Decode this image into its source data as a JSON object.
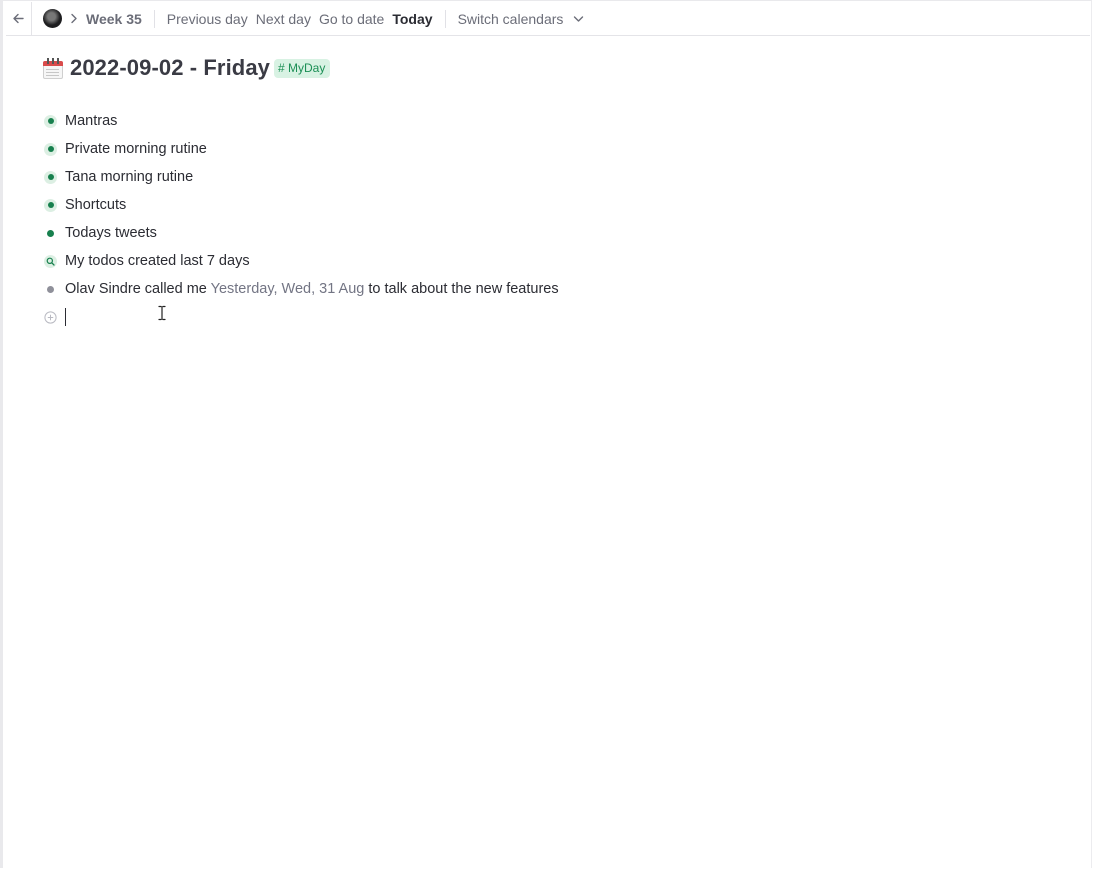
{
  "topbar": {
    "back_icon": "arrow-left-icon",
    "avatar_icon": "user-avatar",
    "breadcrumb_separator_icon": "chevron-right-icon",
    "week_label": "Week 35",
    "previous_day": "Previous day",
    "next_day": "Next day",
    "go_to_date": "Go to date",
    "today": "Today",
    "switch_calendars": "Switch calendars",
    "switch_chevron_icon": "chevron-down-icon"
  },
  "page": {
    "icon": "calendar-emoji-icon",
    "title": "2022-09-02 - Friday",
    "tag": "# MyDay"
  },
  "outline": {
    "nodes": [
      {
        "text": "Mantras",
        "bullet": "collapsed"
      },
      {
        "text": "Private morning rutine",
        "bullet": "collapsed"
      },
      {
        "text": "Tana morning rutine",
        "bullet": "collapsed"
      },
      {
        "text": "Shortcuts",
        "bullet": "collapsed"
      },
      {
        "text": "Todays tweets",
        "bullet": "leaf"
      },
      {
        "text": "My todos created last 7 days",
        "bullet": "search"
      }
    ],
    "call_node": {
      "prefix": "Olav Sindre called me",
      "date_ref": "Yesterday, Wed, 31 Aug",
      "suffix": "to talk about the new features"
    },
    "new_node_icon": "plus-circle-icon"
  },
  "colors": {
    "accent_green": "#17804e",
    "tag_bg": "#d8f2e3",
    "muted_text": "#6b6d78"
  }
}
